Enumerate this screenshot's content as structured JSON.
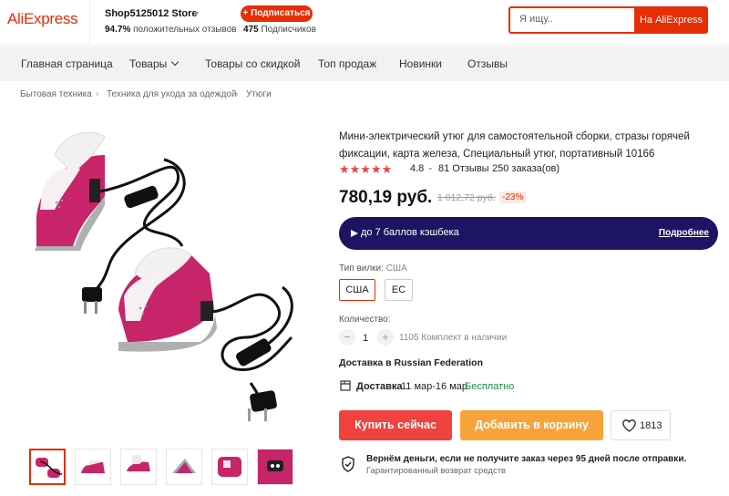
{
  "header": {
    "logo": "AliExpress",
    "store_name": "Shop5125012 Store",
    "store_caret": "▾",
    "positive_pct": "94.7%",
    "positive_label": "положительных отзывов",
    "subscribe_label": "+ Подписаться",
    "subscribers_count": "475",
    "subscribers_label": "Подписчиков",
    "search_placeholder": "Я ищу..",
    "search_button": "На AliExpress"
  },
  "nav": {
    "items": [
      "Главная страница",
      "Товары",
      "Товары со скидкой",
      "Топ продаж",
      "Новинки",
      "Отзывы"
    ]
  },
  "breadcrumb": [
    "Бытовая техника",
    "Техника для ухода за одеждой",
    "Утюги"
  ],
  "product": {
    "title": "Мини-электрический утюг для самостоятельной сборки, стразы горячей фиксации, карта железа, Специальный утюг, портативный 10166",
    "rating": "4.8",
    "rating_value": 4.8,
    "reviews": "81 Отзывы",
    "orders": "250 заказа(ов)",
    "price": "780,19 руб.",
    "old_price": "1 012,72 руб.",
    "discount": "-23%",
    "cashback_text": "до 7 баллов кэшбека",
    "cashback_more": "Подробнее",
    "plug_type_label": "Тип вилки:",
    "plug_type_value": "США",
    "plug_options": [
      "США",
      "ЕС"
    ],
    "quantity_label": "Количество:",
    "quantity": "1",
    "quantity_minus": "−",
    "quantity_plus": "+",
    "stock": "1105 Комплект в наличии",
    "ship_to": "Доставка в Russian Federation",
    "delivery_label": "Доставка",
    "delivery_dates": "11 мар-16 мар",
    "delivery_free": "Бесплатно",
    "buy_now": "Купить сейчас",
    "add_to_cart": "Добавить в корзину",
    "wishlist_count": "1813",
    "guarantee_title": "Вернём деньги, если не получите заказ через 95 дней после отправки.",
    "guarantee_sub": "Гарантированный возврат средств"
  },
  "colors": {
    "accent": "#e62e04",
    "buy": "#f0423e",
    "cart": "#f7a33b",
    "cashback_bg": "#1d1463",
    "iron_pink": "#c8246a",
    "free_green": "#1a8d4e"
  }
}
